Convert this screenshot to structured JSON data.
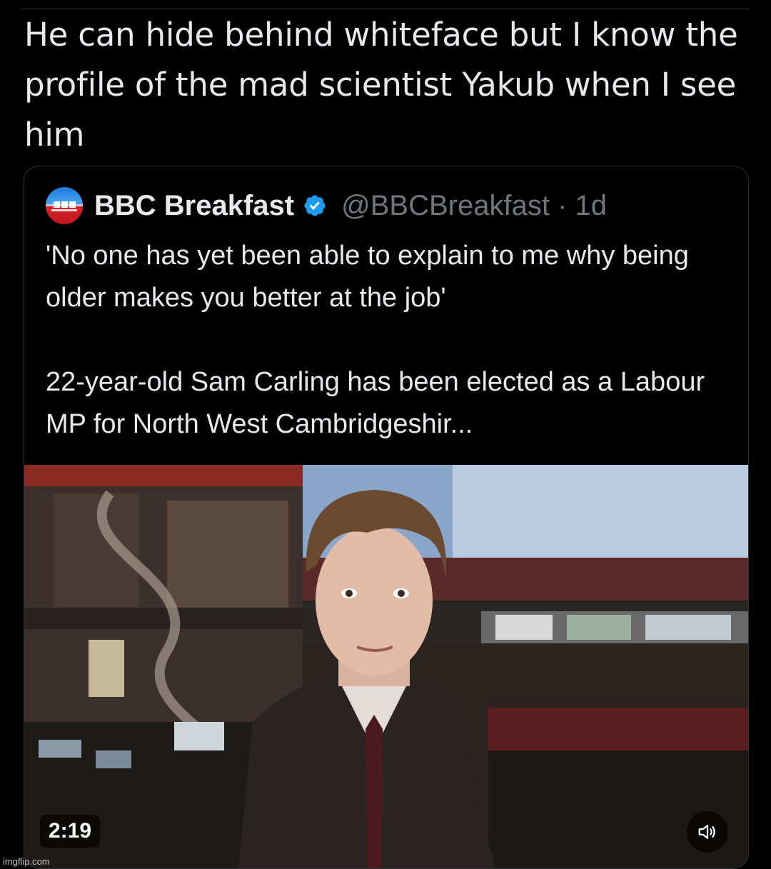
{
  "post": {
    "text": "He can hide behind whiteface but I know the profile of the mad scientist Yakub when I see him"
  },
  "quoted_post": {
    "display_name": "BBC Breakfast",
    "handle_and_time": "@BBCBreakfast · 1d",
    "body_lines": [
      "'No one has yet been able to explain to me why being older makes you better at the job'",
      "22-year-old Sam Carling has been elected as a Labour MP for North West Cambridgeshir..."
    ],
    "video": {
      "duration": "2:19",
      "mute_icon": "speaker-icon"
    }
  },
  "watermark": "imgflip.com",
  "colors": {
    "background": "#000000",
    "text": "#e7e9ea",
    "muted_text": "#71767b",
    "border": "#2f3336",
    "verified": "#1d9bf0"
  }
}
